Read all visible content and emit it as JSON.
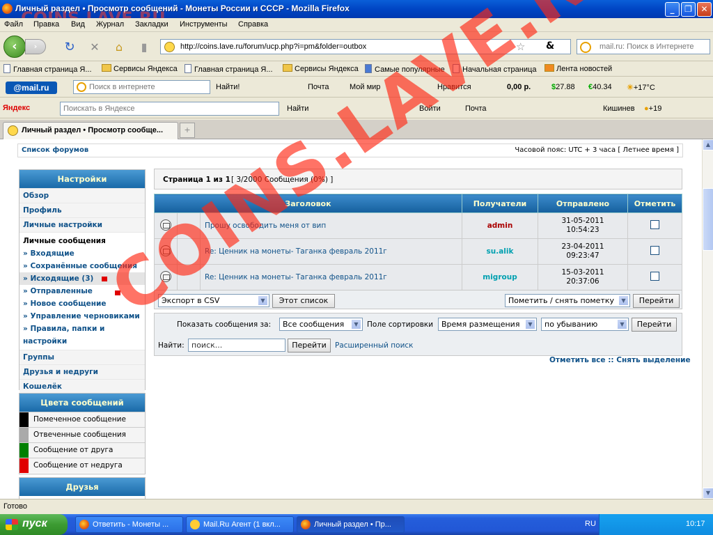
{
  "window": {
    "title": "Личный раздел • Просмотр сообщений - Монеты России и СССР - Mozilla Firefox"
  },
  "menu": [
    "Файл",
    "Правка",
    "Вид",
    "Журнал",
    "Закладки",
    "Инструменты",
    "Справка"
  ],
  "url": "http://coins.lave.ru/forum/ucp.php?i=pm&folder=outbox",
  "search_placeholder": "mail.ru: Поиск в Интернете",
  "bookmarks": [
    "Главная страница Я...",
    "Сервисы Яндекса",
    "Главная страница Я...",
    "Сервисы Яндекса",
    "Самые популярные",
    "Начальная страница",
    "Лента новостей"
  ],
  "mailbar": {
    "logo": "@mail.ru",
    "search_placeholder": "Поиск в интернете",
    "find": "Найти!",
    "mail": "Почта",
    "myworld": "Мой мир",
    "like": "Нравится",
    "money": "0,00 р.",
    "usd": "27.88",
    "eur": "40.34",
    "weather": "+17°C"
  },
  "yandexbar": {
    "logo": "Яндекс",
    "search_placeholder": "Поискать в Яндексе",
    "find": "Найти",
    "login": "Войти",
    "mail": "Почта",
    "city": "Кишинев",
    "temp": "+19"
  },
  "tab": {
    "label": "Личный раздел • Просмотр сообще..."
  },
  "forum": {
    "forum_list": "Список форумов",
    "timezone": "Часовой пояс: UTC + 3 часа [ Летнее время ]",
    "settings_title": "Настройки",
    "settings_items": [
      "Обзор",
      "Профиль",
      "Личные настройки"
    ],
    "pm_title": "Личные сообщения",
    "pm_links": [
      "Входящие",
      "Сохранённые сообщения",
      "Исходящие (3)",
      "Отправленные",
      "Новое сообщение",
      "Управление черновиками",
      "Правила, папки и настройки"
    ],
    "other_items": [
      "Группы",
      "Друзья и недруги",
      "Кошелёк"
    ],
    "colors_title": "Цвета сообщений",
    "colors": [
      {
        "label": "Помеченное сообщение",
        "color": "#000000"
      },
      {
        "label": "Отвеченные сообщения",
        "color": "#aaaaaa"
      },
      {
        "label": "Сообщение от друга",
        "color": "#008000"
      },
      {
        "label": "Сообщение от недруга",
        "color": "#e00000"
      }
    ],
    "friends_title": "Друзья",
    "page_info": "Страница 1 из 1",
    "count_info": "[ 3/2000 Сообщения (0%) ]",
    "columns": [
      "Заголовок",
      "Получатели",
      "Отправлено",
      "Отметить"
    ],
    "messages": [
      {
        "subject": "Прошу освободить меня от вип",
        "recipient": "admin",
        "recipient_color": "#aa0000",
        "date": "31-05-2011",
        "time": "10:54:23"
      },
      {
        "subject": "Re: Ценник на монеты- Таганка февраль 2011г",
        "recipient": "su.alik",
        "recipient_color": "#00a0b0",
        "date": "23-04-2011",
        "time": "09:23:47"
      },
      {
        "subject": "Re: Ценник на монеты- Таганка февраль 2011г",
        "recipient": "migroup",
        "recipient_color": "#00a0b0",
        "date": "15-03-2011",
        "time": "20:37:06"
      }
    ],
    "export_select": "Экспорт в CSV",
    "export_button": "Этот список",
    "mark_select": "Пометить / снять пометку",
    "go": "Перейти",
    "show_label": "Показать сообщения за:",
    "show_value": "Все сообщения",
    "sort_label": "Поле сортировки",
    "sort_value": "Время размещения",
    "order_value": "по убыванию",
    "find_label": "Найти:",
    "find_placeholder": "поиск...",
    "advanced": "Расширенный поиск",
    "mark_all": "Отметить все",
    "sep": "::",
    "unmark_all": "Снять выделение"
  },
  "watermark": "COINS.LAVE.RU",
  "status": "Готово",
  "taskbar": {
    "start": "пуск",
    "tasks": [
      "Ответить - Монеты ...",
      "Mail.Ru Агент (1 вкл...",
      "Личный раздел • Пр..."
    ],
    "lang": "RU",
    "clock": "10:17"
  }
}
